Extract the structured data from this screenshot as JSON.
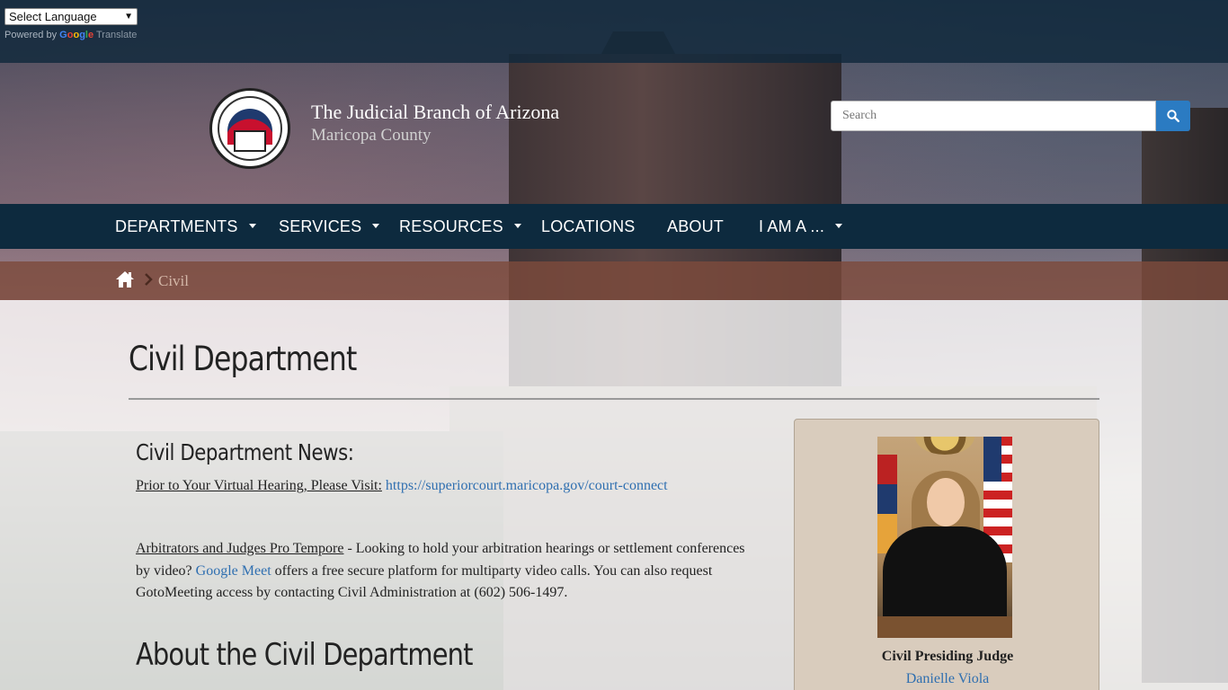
{
  "translate": {
    "select_label": "Select Language",
    "powered_by": "Powered by",
    "google": [
      "G",
      "o",
      "o",
      "g",
      "l",
      "e"
    ],
    "translate_word": "Translate"
  },
  "header": {
    "title": "The Judicial Branch of Arizona",
    "subtitle": "Maricopa County",
    "search_placeholder": "Search"
  },
  "nav": {
    "items": [
      {
        "label": "DEPARTMENTS",
        "dropdown": true
      },
      {
        "label": "SERVICES",
        "dropdown": true
      },
      {
        "label": "RESOURCES",
        "dropdown": true
      },
      {
        "label": "LOCATIONS",
        "dropdown": false
      },
      {
        "label": "ABOUT",
        "dropdown": false
      },
      {
        "label": "I AM A ...",
        "dropdown": true
      }
    ]
  },
  "breadcrumb": {
    "current": "Civil"
  },
  "main": {
    "page_title": "Civil Department",
    "news_heading": "Civil Department News:",
    "news1_label": "Prior to Your Virtual Hearing, Please Visit:",
    "news1_link": "https://superiorcourt.maricopa.gov/court-connect",
    "news2_label": "Arbitrators and Judges Pro Tempore",
    "news2_text_a": " - Looking to hold your arbitration hearings or settlement conferences by video? ",
    "news2_link": "Google Meet",
    "news2_text_b": " offers a free secure platform for multiparty video calls.  You can also request GotoMeeting access by contacting Civil Administration at (602) 506-1497.",
    "about_heading": "About the Civil Department"
  },
  "judge": {
    "title": "Civil Presiding Judge",
    "name": "Danielle Viola"
  },
  "colors": {
    "nav_bg": "#0d2a3e",
    "breadcrumb_bg": "#7d4b3c",
    "link": "#2f6fb0",
    "search_button": "#2b7bc2"
  }
}
